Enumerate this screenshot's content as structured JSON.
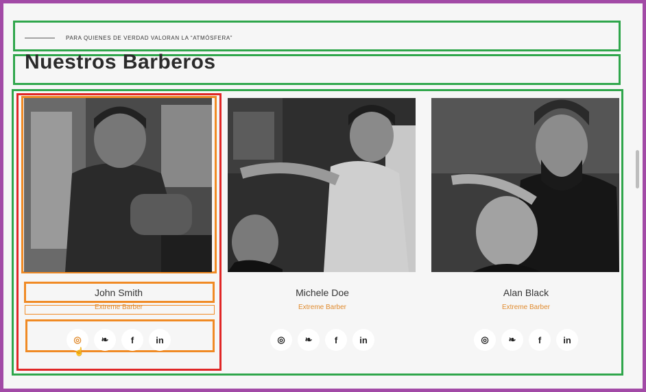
{
  "header": {
    "tagline": "PARA QUIENES DE VERDAD VALORAN LA “ATMÓSFERA”",
    "title": "Nuestros Barberos"
  },
  "barbers": [
    {
      "name": "John Smith",
      "role": "Extreme Barber"
    },
    {
      "name": "Michele Doe",
      "role": "Extreme Barber"
    },
    {
      "name": "Alan Black",
      "role": "Extreme Barber"
    }
  ],
  "social_icons": [
    "instagram-icon",
    "twitter-icon",
    "facebook-icon",
    "linkedin-icon"
  ],
  "social_glyphs": {
    "instagram": "◎",
    "twitter": "❧",
    "facebook": "f",
    "linkedin": "in"
  },
  "colors": {
    "accent": "#e08a2c",
    "frame": "#a24aa6",
    "highlight_green": "#2fa64b",
    "highlight_red": "#e02626",
    "highlight_orange": "#f08a24"
  }
}
